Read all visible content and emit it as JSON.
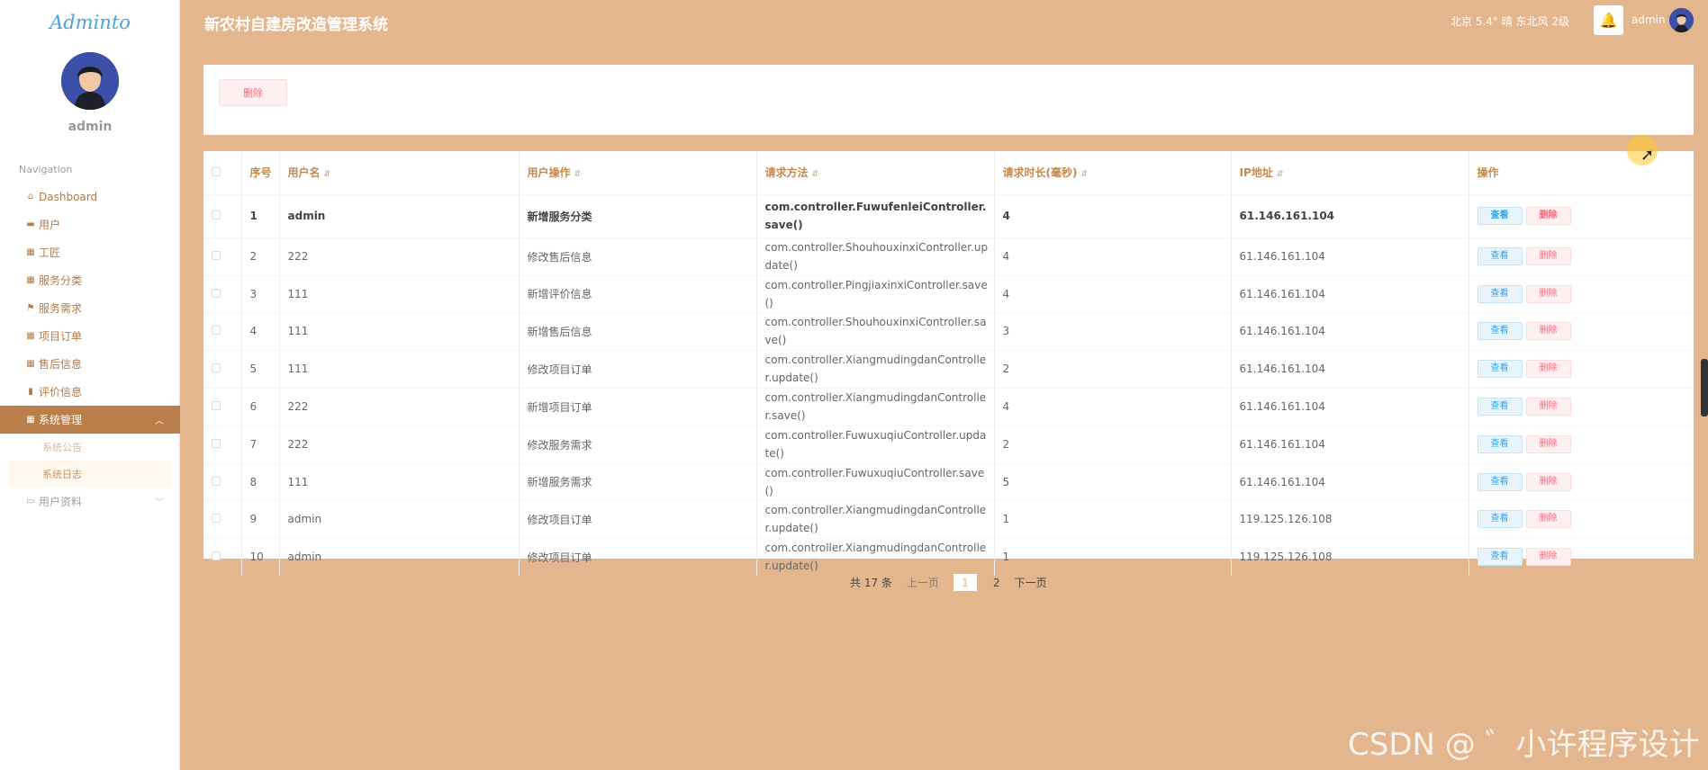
{
  "sidebar": {
    "logo": "Adminto",
    "username": "admin",
    "nav_label": "Navigation",
    "items": [
      {
        "label": "Dashboard",
        "icon": "home-icon"
      },
      {
        "label": "用户",
        "icon": "card-icon"
      },
      {
        "label": "工匠",
        "icon": "grid-icon"
      },
      {
        "label": "服务分类",
        "icon": "grid-icon"
      },
      {
        "label": "服务需求",
        "icon": "flag-icon"
      },
      {
        "label": "项目订单",
        "icon": "grid-icon"
      },
      {
        "label": "售后信息",
        "icon": "grid-icon"
      },
      {
        "label": "评价信息",
        "icon": "bar-chart-icon"
      },
      {
        "label": "系统管理",
        "icon": "grid-icon"
      }
    ],
    "sub_items": [
      "系统公告",
      "系统日志"
    ],
    "profile": {
      "label": "用户资料",
      "icon": "calendar-icon"
    }
  },
  "header": {
    "title": "新农村自建房改造管理系统",
    "weather": "北京  5.4°  晴  东北风  2级",
    "user": "admin"
  },
  "actions": {
    "batch_delete": "删除"
  },
  "table": {
    "columns": [
      "序号",
      "用户名",
      "用户操作",
      "请求方法",
      "请求时长(毫秒)",
      "IP地址",
      "操作"
    ],
    "view_label": "查看",
    "delete_label": "删除",
    "rows": [
      {
        "no": "1",
        "user": "admin",
        "op": "新增服务分类",
        "method": "com.controller.FuwufenleiController.save()",
        "duration": "4",
        "ip": "61.146.161.104"
      },
      {
        "no": "2",
        "user": "222",
        "op": "修改售后信息",
        "method": "com.controller.ShouhouxinxiController.update()",
        "duration": "4",
        "ip": "61.146.161.104"
      },
      {
        "no": "3",
        "user": "111",
        "op": "新增评价信息",
        "method": "com.controller.PingjiaxinxiController.save()",
        "duration": "4",
        "ip": "61.146.161.104"
      },
      {
        "no": "4",
        "user": "111",
        "op": "新增售后信息",
        "method": "com.controller.ShouhouxinxiController.save()",
        "duration": "3",
        "ip": "61.146.161.104"
      },
      {
        "no": "5",
        "user": "111",
        "op": "修改项目订单",
        "method": "com.controller.XiangmudingdanController.update()",
        "duration": "2",
        "ip": "61.146.161.104"
      },
      {
        "no": "6",
        "user": "222",
        "op": "新增项目订单",
        "method": "com.controller.XiangmudingdanController.save()",
        "duration": "4",
        "ip": "61.146.161.104"
      },
      {
        "no": "7",
        "user": "222",
        "op": "修改服务需求",
        "method": "com.controller.FuwuxuqiuController.update()",
        "duration": "2",
        "ip": "61.146.161.104"
      },
      {
        "no": "8",
        "user": "111",
        "op": "新增服务需求",
        "method": "com.controller.FuwuxuqiuController.save()",
        "duration": "5",
        "ip": "61.146.161.104"
      },
      {
        "no": "9",
        "user": "admin",
        "op": "修改项目订单",
        "method": "com.controller.XiangmudingdanController.update()",
        "duration": "1",
        "ip": "119.125.126.108"
      },
      {
        "no": "10",
        "user": "admin",
        "op": "修改项目订单",
        "method": "com.controller.XiangmudingdanController.update()",
        "duration": "1",
        "ip": "119.125.126.108"
      }
    ]
  },
  "pager": {
    "total": "共 17 条",
    "prev": "上一页",
    "pages": [
      "1",
      "2"
    ],
    "next": "下一页"
  },
  "watermark": "CSDN @ ゛小许程序设计",
  "colors": {
    "background": "#e3b68d",
    "accent": "#b97e4a",
    "header_text": "#c7884e",
    "danger": "#f36c81",
    "info": "#3aa3e0"
  }
}
